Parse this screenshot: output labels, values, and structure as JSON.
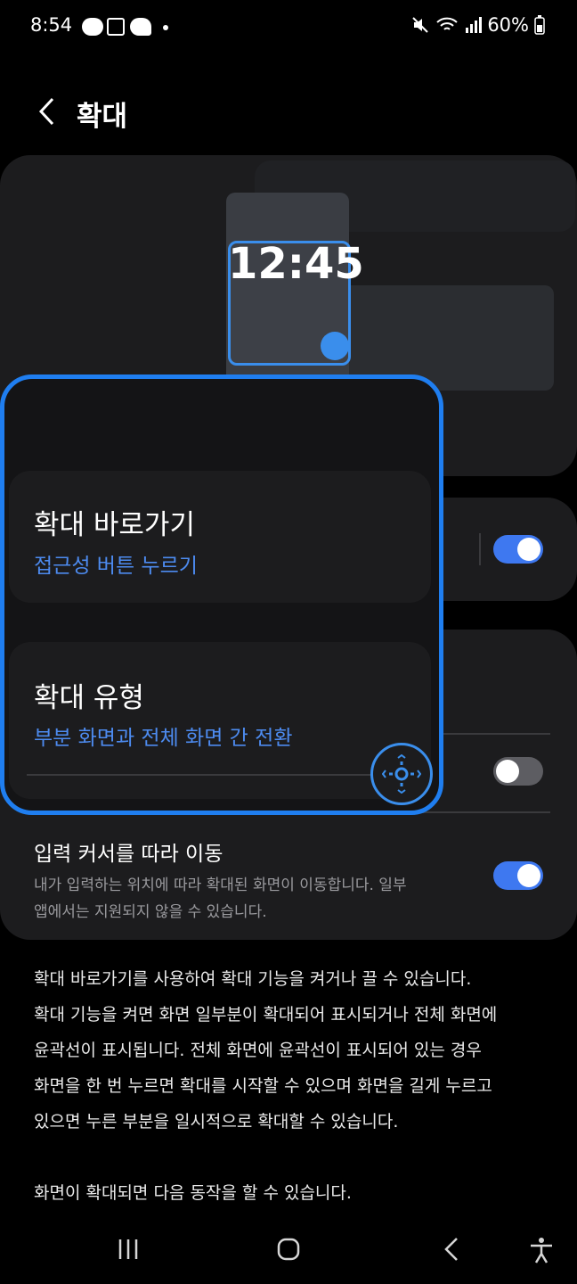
{
  "status": {
    "time": "8:54",
    "battery": "60%"
  },
  "header": {
    "title": "확대",
    "back_icon": "chevron-left-icon"
  },
  "preview": {
    "clock": "12:45"
  },
  "shortcut": {
    "title": "확대 바로가기",
    "subtitle": "접근성 버튼 누르기",
    "enabled": true
  },
  "magnification_type": {
    "title": "확대 유형",
    "subtitle": "부분 화면과 전체 화면 간 전환"
  },
  "second_toggle": {
    "enabled": false
  },
  "follow_cursor": {
    "title": "입력 커서를 따라 이동",
    "description_line1": "내가 입력하는 위치에 따라 확대된 화면이 이동합니다. 일부",
    "description_line2": "앱에서는 지원되지 않을 수 있습니다.",
    "enabled": true
  },
  "description": {
    "lines": [
      "확대 바로가기를 사용하여 확대 기능을 켜거나 끌 수 있습니다.",
      "확대 기능을 켜면 화면 일부분이 확대되어 표시되거나 전체 화면에",
      "윤곽선이 표시됩니다. 전체 화면에 윤곽선이 표시되어 있는 경우",
      "화면을 한 번 누르면 확대를 시작할 수 있으며 화면을 길게 누르고",
      "있으면 누른 부분을 일시적으로 확대할 수 있습니다."
    ],
    "footer": "화면이 확대되면 다음 동작을 할 수 있습니다."
  },
  "colors": {
    "accent": "#3e78f0",
    "magnifier_border": "#1f7ef0",
    "card": "#1c1c1e"
  }
}
